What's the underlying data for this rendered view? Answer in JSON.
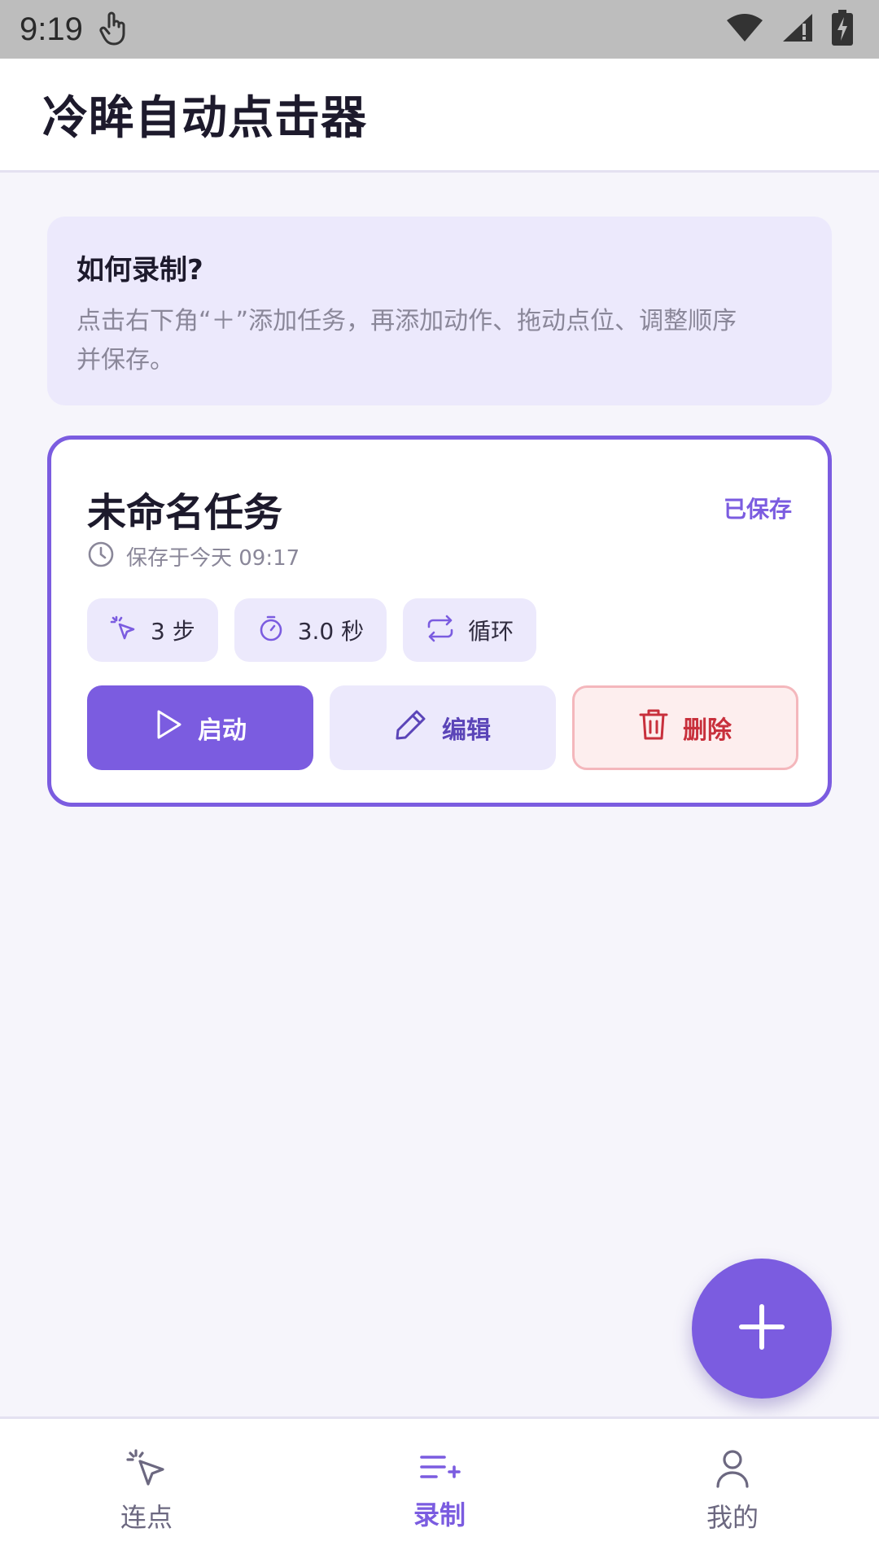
{
  "status_bar": {
    "time": "9:19"
  },
  "app_bar": {
    "title": "冷眸自动点击器"
  },
  "help": {
    "title": "如何录制?",
    "body_line1": "点击右下角“＋”添加任务，再添加动作、拖动点位、调整顺序",
    "body_line2": "并保存。"
  },
  "task": {
    "name": "未命名任务",
    "saved_label": "已保存",
    "saved_time": "保存于今天 09:17",
    "chips": {
      "steps": "3 步",
      "duration": "3.0 秒",
      "mode": "循环"
    },
    "buttons": {
      "start": "启动",
      "edit": "编辑",
      "delete": "删除"
    }
  },
  "bottom_nav": {
    "items": [
      {
        "label": "连点",
        "icon": "tap-icon"
      },
      {
        "label": "录制",
        "icon": "list-add-icon"
      },
      {
        "label": "我的",
        "icon": "user-icon"
      }
    ],
    "active_index": 1
  },
  "colors": {
    "accent": "#7b5ce0",
    "danger": "#c8303c",
    "surface": "#ece9fc"
  }
}
